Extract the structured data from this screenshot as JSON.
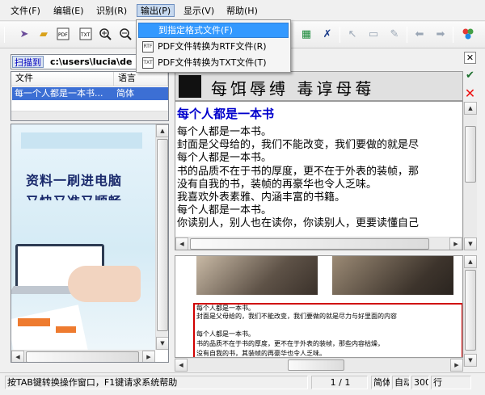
{
  "menu": {
    "items": [
      "文件(F)",
      "编辑(E)",
      "识别(R)",
      "输出(P)",
      "显示(V)",
      "帮助(H)"
    ],
    "active_index": 3
  },
  "dropdown": {
    "items": [
      {
        "label": "到指定格式文件(F)",
        "icon": "format-file-icon",
        "selected": true
      },
      {
        "label": "PDF文件转换为RTF文件(R)",
        "icon": "rtf-icon",
        "icon_text": "RTF"
      },
      {
        "label": "PDF文件转换为TXT文件(T)",
        "icon": "txt-icon",
        "icon_text": "TXT"
      }
    ]
  },
  "left_panel": {
    "scan_label": "扫描到",
    "scan_path": "c:\\users\\lucia\\de",
    "columns": [
      "文件",
      "语言"
    ],
    "rows": [
      {
        "file": "每一个人都是一本书...",
        "language": "简体"
      }
    ],
    "preview_text_1": "资料一刷进电脑",
    "preview_text_2": "又快又准又顺畅"
  },
  "ocr_header_text": "每饵辱缚 毒谆母莓",
  "document": {
    "title": "每个人都是一本书",
    "lines": [
      "每个人都是一本书。",
      "封面是父母给的，我们不能改变，我们要做的就是尽",
      "每个人都是一本书。",
      "书的品质不在于书的厚度，更不在于外表的装帧，那",
      "没有自我的书，装帧的再豪华也令人乏味。",
      "我喜欢外表素雅、内涵丰富的书籍。",
      "每个人都是一本书。",
      "你读别人，别人也在读你，你读别人，更要读懂自己"
    ]
  },
  "image_text": {
    "lines": [
      "每个人都是一本书。",
      "封面是父母给的，我们不能改变，我们要做的就是尽力与好里面的内容",
      "",
      "每个人都是一本书。",
      "书的品质不在于书的厚度，更不在于外表的装帧，那些内容枯燥，",
      "没有自我的书，其装帧的再豪华也令人乏味。"
    ]
  },
  "status": {
    "hint": "按TAB键转换操作窗口，F1键请求系统帮助",
    "page": "1 / 1",
    "field_1": "简体",
    "field_2": "自动",
    "field_3": "300",
    "field_4": "行"
  },
  "colors": {
    "title_blue": "#0000cc",
    "selection_blue": "#3399ff",
    "list_select": "#3c6fd4",
    "red_box": "#d00000"
  }
}
